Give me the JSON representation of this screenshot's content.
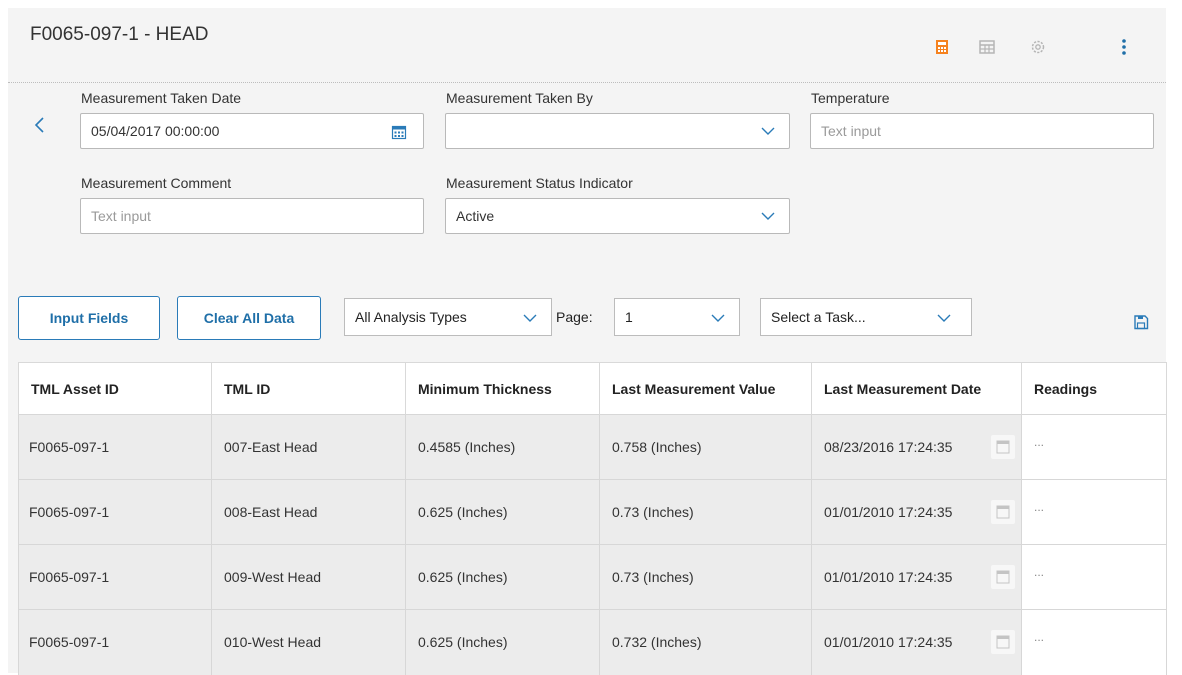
{
  "header": {
    "title": "F0065-097-1 - HEAD"
  },
  "form": {
    "measurement_taken_date": {
      "label": "Measurement Taken Date",
      "value": "05/04/2017 00:00:00"
    },
    "measurement_taken_by": {
      "label": "Measurement Taken By",
      "value": ""
    },
    "temperature": {
      "label": "Temperature",
      "placeholder": "Text input"
    },
    "measurement_comment": {
      "label": "Measurement Comment",
      "placeholder": "Text input"
    },
    "measurement_status_indicator": {
      "label": "Measurement Status Indicator",
      "value": "Active"
    }
  },
  "toolbar": {
    "input_fields_label": "Input Fields",
    "clear_all_data_label": "Clear All Data",
    "analysis_types": "All Analysis Types",
    "page_label": "Page:",
    "page_value": "1",
    "task_select": "Select a Task..."
  },
  "table": {
    "columns": [
      "TML Asset ID",
      "TML ID",
      "Minimum Thickness",
      "Last Measurement Value",
      "Last Measurement Date",
      "Readings"
    ],
    "rows": [
      {
        "asset_id": "F0065-097-1",
        "tml_id": "007-East Head",
        "min_thickness": "0.4585 (Inches)",
        "last_value": "0.758 (Inches)",
        "last_date": "08/23/2016 17:24:35",
        "readings": "..."
      },
      {
        "asset_id": "F0065-097-1",
        "tml_id": "008-East Head",
        "min_thickness": "0.625 (Inches)",
        "last_value": "0.73 (Inches)",
        "last_date": "01/01/2010 17:24:35",
        "readings": "..."
      },
      {
        "asset_id": "F0065-097-1",
        "tml_id": "009-West Head",
        "min_thickness": "0.625 (Inches)",
        "last_value": "0.73 (Inches)",
        "last_date": "01/01/2010 17:24:35",
        "readings": "..."
      },
      {
        "asset_id": "F0065-097-1",
        "tml_id": "010-West Head",
        "min_thickness": "0.625 (Inches)",
        "last_value": "0.732 (Inches)",
        "last_date": "01/01/2010 17:24:35",
        "readings": "..."
      }
    ]
  },
  "icons": {
    "header": [
      "calculator-icon",
      "table-view-icon",
      "gear-icon",
      "more-vertical-icon"
    ],
    "accent_orange": "#f5821f",
    "accent_blue": "#1f6fa8"
  }
}
